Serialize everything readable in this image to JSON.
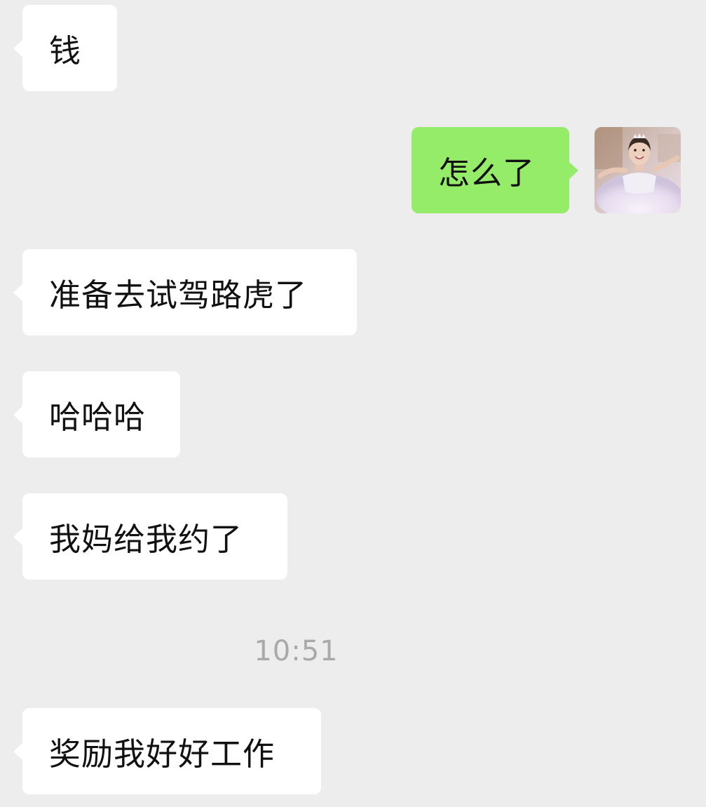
{
  "messages": [
    {
      "side": "in",
      "text": "钱"
    },
    {
      "side": "out",
      "text": "怎么了"
    },
    {
      "side": "in",
      "text": "准备去试驾路虎了"
    },
    {
      "side": "in",
      "text": "哈哈哈"
    },
    {
      "side": "in",
      "text": "我妈给我约了"
    },
    {
      "side": "in",
      "text": "奖励我好好工作"
    }
  ],
  "timestamp": "10:51",
  "colors": {
    "background": "#ededed",
    "incoming_bubble": "#ffffff",
    "outgoing_bubble": "#95ec69",
    "timestamp_text": "#a9a9a9"
  }
}
